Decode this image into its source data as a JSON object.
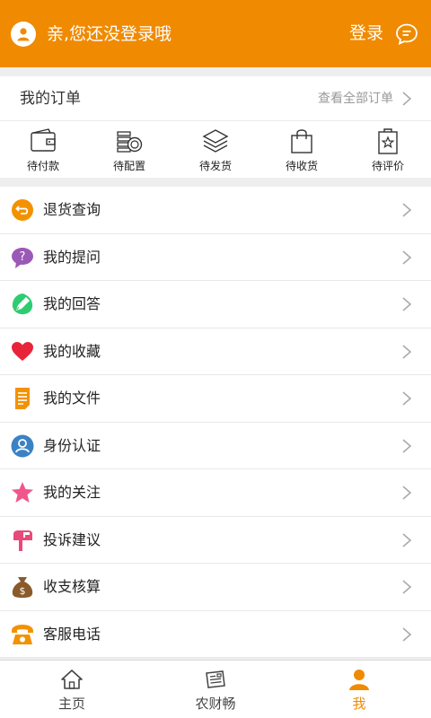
{
  "colors": {
    "accent": "#f08a00",
    "background": "#eeeeee"
  },
  "header": {
    "greeting": "亲,您还没登录哦",
    "login_label": "登录",
    "avatar_icon": "user-avatar-icon",
    "message_icon": "message-icon"
  },
  "orders": {
    "title": "我的订单",
    "view_all": "查看全部订单",
    "statuses": [
      {
        "label": "待付款",
        "icon": "wallet-icon"
      },
      {
        "label": "待配置",
        "icon": "coins-icon"
      },
      {
        "label": "待发货",
        "icon": "layers-icon"
      },
      {
        "label": "待收货",
        "icon": "bag-icon"
      },
      {
        "label": "待评价",
        "icon": "review-star-icon"
      }
    ]
  },
  "menu": {
    "items": [
      {
        "label": "退货查询",
        "icon": "return-icon"
      },
      {
        "label": "我的提问",
        "icon": "question-icon"
      },
      {
        "label": "我的回答",
        "icon": "answer-pen-icon"
      },
      {
        "label": "我的收藏",
        "icon": "heart-icon"
      },
      {
        "label": "我的文件",
        "icon": "document-icon"
      },
      {
        "label": "身份认证",
        "icon": "identity-icon"
      },
      {
        "label": "我的关注",
        "icon": "star-icon"
      },
      {
        "label": "投诉建议",
        "icon": "mailbox-icon"
      },
      {
        "label": "收支核算",
        "icon": "money-bag-icon"
      },
      {
        "label": "客服电话",
        "icon": "phone-icon"
      }
    ]
  },
  "tabbar": {
    "tabs": [
      {
        "label": "主页",
        "icon": "home-icon"
      },
      {
        "label": "农财畅",
        "icon": "newspaper-icon"
      },
      {
        "label": "我",
        "icon": "profile-icon"
      }
    ],
    "active_index": 2
  }
}
